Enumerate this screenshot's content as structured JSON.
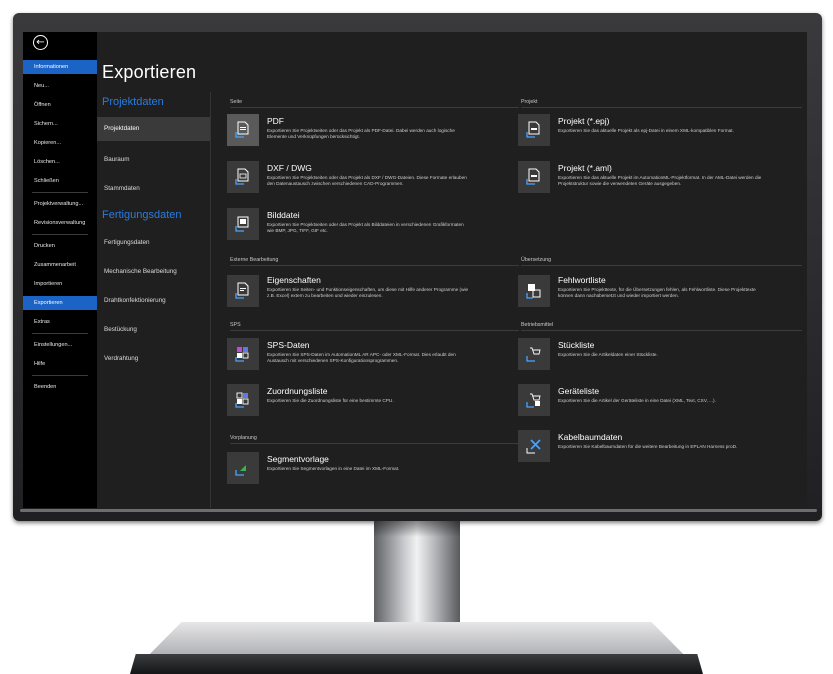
{
  "colors": {
    "accent": "#1c63c6",
    "heading_blue": "#2a7be0",
    "background": "#1f1f1f",
    "sidebar": "#000000"
  },
  "backstage": {
    "back_icon": "arrow-left-circle-icon",
    "items": [
      {
        "label": "Informationen",
        "active": true
      },
      {
        "label": "Neu..."
      },
      {
        "label": "Öffnen"
      },
      {
        "label": "Sichern..."
      },
      {
        "label": "Kopieren..."
      },
      {
        "label": "Löschen..."
      },
      {
        "label": "Schließen"
      },
      {
        "label": "Projektverwaltung..."
      },
      {
        "label": "Revisionsverwaltung"
      },
      {
        "label": "Drucken"
      },
      {
        "label": "Zusammenarbeit"
      },
      {
        "label": "Importieren"
      },
      {
        "label": "Exportieren",
        "highlight": true
      },
      {
        "label": "Extras"
      },
      {
        "label": "Einstellungen..."
      },
      {
        "label": "Hilfe"
      },
      {
        "label": "Beenden"
      }
    ]
  },
  "page": {
    "title": "Exportieren"
  },
  "nav": {
    "group1": "Projektdaten",
    "group1_items": [
      "Projektdaten",
      "Bauraum",
      "Stammdaten"
    ],
    "group2": "Fertigungsdaten",
    "group2_items": [
      "Fertigungsdaten",
      "Mechanische Bearbeitung",
      "Drahtkonfektionierung",
      "Bestückung",
      "Verdrahtung"
    ]
  },
  "sections": {
    "seite": "Seite",
    "projekt": "Projekt",
    "externe": "Externe Bearbeitung",
    "uebersetzung": "Übersetzung",
    "sps": "SPS",
    "betriebsmittel": "Betriebsmittel",
    "vorplanung": "Vorplanung"
  },
  "items": {
    "pdf": {
      "title": "PDF",
      "desc": "Exportieren Sie Projektseiten oder das Projekt als PDF-Datei. Dabei werden auch logische Elemente und Verknüpfungen berücksichtigt.",
      "icon": "pdf-export-icon"
    },
    "dxf": {
      "title": "DXF / DWG",
      "desc": "Exportieren Sie Projektseiten oder das Projekt als DXF / DWG-Dateien. Diese Formate erlauben den Datenaustausch zwischen verschiedenen CAD-Programmen.",
      "icon": "dxf-export-icon"
    },
    "bild": {
      "title": "Bilddatei",
      "desc": "Exportieren Sie Projektseiten oder das Projekt als Bilddateien in verschiedenen Grafikformaten wie BMP, JPG, TIFF, GIF etc.",
      "icon": "image-export-icon"
    },
    "epj": {
      "title": "Projekt (*.epj)",
      "desc": "Exportieren Sie das aktuelle Projekt als epj-Datei in einem XML-kompatiblen Format.",
      "icon": "epj-export-icon"
    },
    "aml": {
      "title": "Projekt (*.aml)",
      "desc": "Exportieren Sie das aktuelle Projekt im AutomationML-Projektformat. In der AML-Datei werden die Projektstruktur sowie die verwendeten Geräte ausgegeben.",
      "icon": "aml-export-icon"
    },
    "eigenschaften": {
      "title": "Eigenschaften",
      "desc": "Exportieren Sie Seiten- und Funktionseigenschaften, um diese mit Hilfe anderer Programme (wie z.B. Excel) extern zu bearbeiten und wieder einzulesen.",
      "icon": "properties-export-icon"
    },
    "fehlwort": {
      "title": "Fehlwortliste",
      "desc": "Exportieren Sie Projekttexte, für die Übersetzungen fehlen, als Fehlwortliste. Diese Projekttexte können dann nachübersetzt und wieder importiert werden.",
      "icon": "translation-export-icon"
    },
    "sps": {
      "title": "SPS-Daten",
      "desc": "Exportieren Sie SPS-Daten im AutomationML AR APC- oder XML-Format. Dies erlaubt den Austausch mit verschiedenen SPS-Konfigurationsprogrammen.",
      "icon": "plc-export-icon"
    },
    "stueck": {
      "title": "Stückliste",
      "desc": "Exportieren Sie die Artikeldaten einer Stückliste.",
      "icon": "cart-export-icon"
    },
    "zuord": {
      "title": "Zuordnungsliste",
      "desc": "Exportieren Sie die Zuordnungsliste für eine bestimmte CPU.",
      "icon": "assignment-export-icon"
    },
    "geraete": {
      "title": "Geräteliste",
      "desc": "Exportieren Sie die Artikel der Geräteliste in eine Datei (XML, Text, CSV, ...).",
      "icon": "device-list-export-icon"
    },
    "segment": {
      "title": "Segmentvorlage",
      "desc": "Exportieren Sie Segmentvorlagen in eine Datei im XML-Format.",
      "icon": "segment-export-icon"
    },
    "kabel": {
      "title": "Kabelbaumdaten",
      "desc": "Exportieren Sie Kabelbaumdaten für die weitere Bearbeitung in EPLAN Harness proD.",
      "icon": "harness-export-icon"
    }
  }
}
